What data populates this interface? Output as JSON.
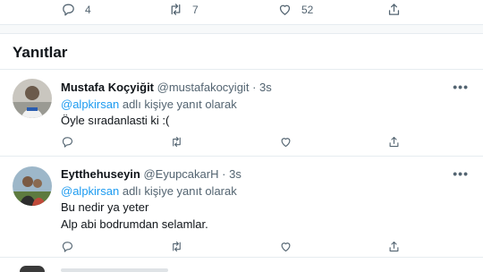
{
  "top_actions": {
    "reply_count": "4",
    "retweet_count": "7",
    "like_count": "52"
  },
  "section": {
    "title": "Yanıtlar"
  },
  "replies": [
    {
      "name": "Mustafa Koçyiğit",
      "handle": "@mustafakocyigit",
      "dot": "·",
      "time": "3s",
      "more": "•••",
      "mention": "@alpkirsan",
      "replying_suffix": " adlı kişiye yanıt olarak",
      "lines": [
        "Öyle sıradanlasti ki :("
      ]
    },
    {
      "name": "Eytthehuseyin",
      "handle": "@EyupcakarH",
      "dot": "·",
      "time": "3s",
      "more": "•••",
      "mention": "@alpkirsan",
      "replying_suffix": " adlı kişiye yanıt olarak",
      "lines": [
        "Bu nedir ya yeter",
        "Alp abi bodrumdan selamlar."
      ]
    }
  ],
  "colors": {
    "accent": "#1d9bf0",
    "muted": "#536471",
    "text": "#0f1419",
    "divider": "#e6ecf0"
  },
  "icons": [
    "reply-icon",
    "retweet-icon",
    "like-icon",
    "share-icon",
    "more-icon"
  ]
}
